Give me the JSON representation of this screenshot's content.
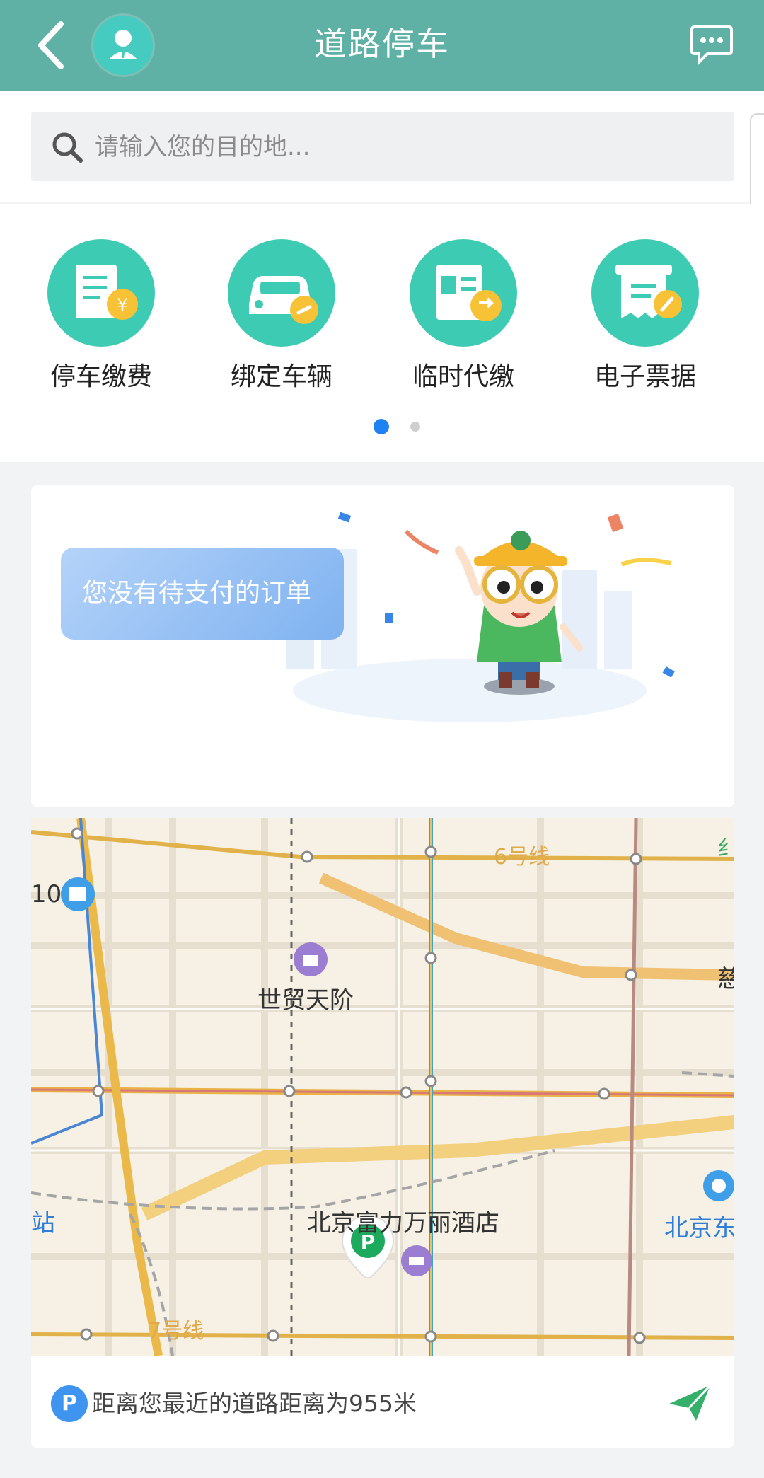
{
  "header": {
    "title": "道路停车",
    "back_icon": "chevron-left-icon",
    "avatar_icon": "user-avatar-icon",
    "message_icon": "chat-bubble-icon",
    "bg_color": "#5fb1a5"
  },
  "search": {
    "placeholder": "请输入您的目的地...",
    "icon": "search-icon"
  },
  "services": {
    "items": [
      {
        "label": "停车缴费",
        "icon": "parking-payment-icon"
      },
      {
        "label": "绑定车辆",
        "icon": "bind-vehicle-icon"
      },
      {
        "label": "临时代缴",
        "icon": "temporary-payment-icon"
      },
      {
        "label": "电子票据",
        "icon": "e-receipt-icon"
      }
    ],
    "page_count": 2,
    "active_page": 1,
    "accent_color": "#3ecbb3"
  },
  "banner": {
    "message": "您没有待支付的订单"
  },
  "map": {
    "labels": {
      "line6": "6号线",
      "line7": "7号线",
      "shimao": "世贸天阶",
      "hotel": "北京富力万丽酒店",
      "station_right": "北京东",
      "station_left": "站",
      "edge_left": "10",
      "edge_right_1": "纟",
      "edge_right_2": "慈"
    }
  },
  "footer": {
    "badge": "P",
    "distance_text": "距离您最近的道路距离为955米",
    "nav_icon": "navigate-arrow-icon"
  }
}
